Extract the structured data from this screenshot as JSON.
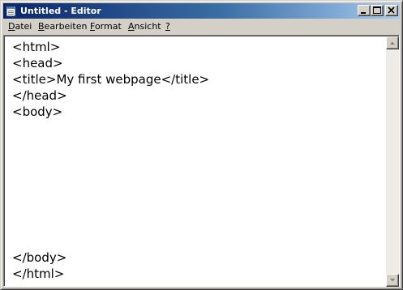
{
  "window": {
    "title": "Untitled - Editor",
    "icon": "notepad-icon",
    "controls": [
      "minimize-icon",
      "maximize-icon",
      "close-icon"
    ]
  },
  "menu": {
    "items": [
      {
        "accel": "D",
        "rest": "atei"
      },
      {
        "accel": "B",
        "rest": "earbeiten"
      },
      {
        "accel": "F",
        "rest": "ormat"
      },
      {
        "accel": "A",
        "rest": "nsicht"
      },
      {
        "accel": "?",
        "rest": ""
      }
    ]
  },
  "editor": {
    "lines": [
      "<html>",
      "<head>",
      "<title>My first webpage</title>",
      "</head>",
      "<body>",
      "",
      "",
      "",
      "",
      "",
      "",
      "",
      "",
      "</body>",
      "</html>"
    ]
  },
  "scrollbar": {
    "up_icon": "arrow-up-icon",
    "down_icon": "arrow-down-icon"
  },
  "colors": {
    "titlebar_start": "#0a246a",
    "titlebar_end": "#a6caf0",
    "chrome": "#d4d0c8",
    "editor_bg": "#ffffff"
  }
}
